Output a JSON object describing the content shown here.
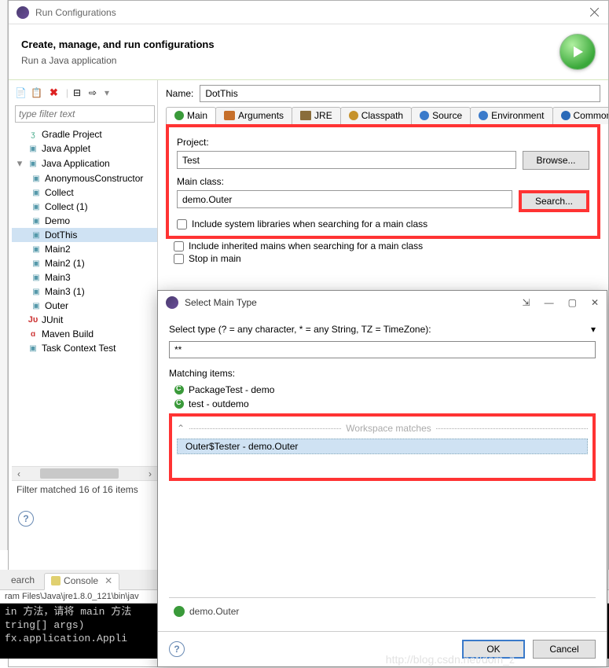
{
  "window": {
    "title": "Run Configurations"
  },
  "header": {
    "title": "Create, manage, and run configurations",
    "subtitle": "Run a Java application"
  },
  "left": {
    "filter_placeholder": "type filter text",
    "items": [
      {
        "label": "Gradle Project",
        "type": "gradle"
      },
      {
        "label": "Java Applet",
        "type": "j"
      },
      {
        "label": "Java Application",
        "type": "j",
        "expanded": true,
        "children": [
          {
            "label": "AnonymousConstructor"
          },
          {
            "label": "Collect"
          },
          {
            "label": "Collect (1)"
          },
          {
            "label": "Demo"
          },
          {
            "label": "DotThis",
            "selected": true
          },
          {
            "label": "Main2"
          },
          {
            "label": "Main2 (1)"
          },
          {
            "label": "Main3"
          },
          {
            "label": "Main3 (1)"
          },
          {
            "label": "Outer"
          }
        ]
      },
      {
        "label": "JUnit",
        "type": "ju"
      },
      {
        "label": "Maven Build",
        "type": "mv"
      },
      {
        "label": "Task Context Test",
        "type": "task"
      }
    ],
    "status": "Filter matched 16 of 16 items"
  },
  "right": {
    "name_label": "Name:",
    "name_value": "DotThis",
    "tabs": [
      "Main",
      "Arguments",
      "JRE",
      "Classpath",
      "Source",
      "Environment",
      "Common"
    ],
    "project_label": "Project:",
    "project_value": "Test",
    "browse": "Browse...",
    "mainclass_label": "Main class:",
    "mainclass_value": "demo.Outer",
    "search": "Search...",
    "cb1": "Include system libraries when searching for a main class",
    "cb2": "Include inherited mains when searching for a main class",
    "cb3": "Stop in main"
  },
  "popup": {
    "title": "Select Main Type",
    "prompt": "Select type (? = any character, * = any String, TZ = TimeZone):",
    "search_value": "**",
    "matching_label": "Matching items:",
    "items": [
      {
        "label": "PackageTest - demo"
      },
      {
        "label": "test - outdemo"
      }
    ],
    "workspace_label": "Workspace matches",
    "selected": "Outer$Tester - demo.Outer",
    "footer": "demo.Outer",
    "ok": "OK",
    "cancel": "Cancel"
  },
  "console": {
    "tab_search": "earch",
    "tab_console": "Console",
    "path": "ram Files\\Java\\jre1.8.0_121\\bin\\jav",
    "lines": "in 方法，请将 main 方法\ntring[] args)\nfx.application.Appli"
  },
  "watermark": "http://blog.csdn.net/dom_z"
}
